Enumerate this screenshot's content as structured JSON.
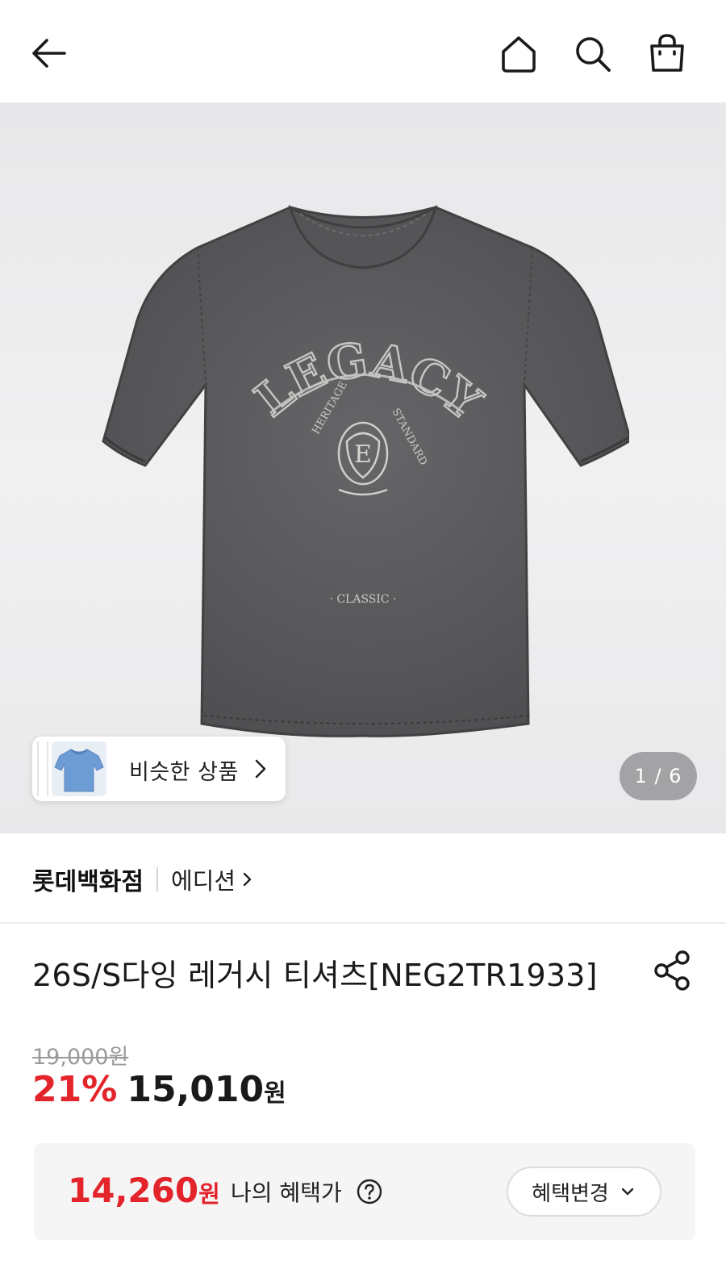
{
  "header": {
    "back_icon": "arrow-left-icon",
    "home_icon": "home-icon",
    "search_icon": "search-icon",
    "bag_icon": "shopping-bag-icon"
  },
  "gallery": {
    "print_lettering": [
      "LEGACY",
      "HERITAGE",
      "STANDARD",
      "CLASSIC"
    ],
    "similar_label": "비슷한 상품",
    "page_indicator": "1 / 6"
  },
  "brand": {
    "store": "롯데백화점",
    "sub_brand": "에디션"
  },
  "product": {
    "title": "26S/S다잉 레거시 티셔츠[NEG2TR1933]",
    "original_price": "19,000원",
    "discount": "21%",
    "price": "15,010",
    "price_unit": "원"
  },
  "benefit": {
    "price": "14,260",
    "price_unit": "원",
    "label": "나의 혜택가",
    "change_label": "혜택변경"
  },
  "colors": {
    "accent_red": "#e3242b",
    "shirt": "#5a5a5c"
  }
}
